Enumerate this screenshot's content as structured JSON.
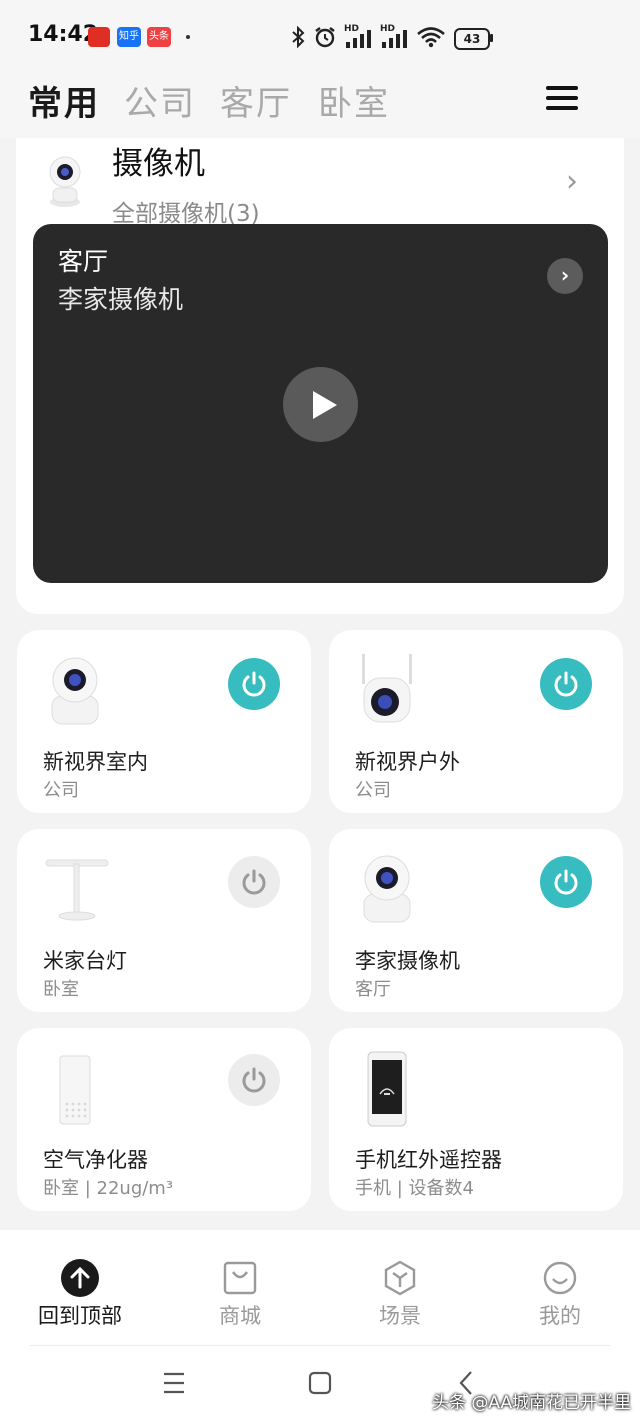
{
  "status_bar": {
    "time": "14:42",
    "app_icons": [
      "拼多多",
      "知乎",
      "头条"
    ],
    "battery": "43",
    "hd1": "HD",
    "hd2": "HD"
  },
  "tabs": [
    "常用",
    "公司",
    "客厅",
    "卧室"
  ],
  "active_tab": "常用",
  "camera_card": {
    "title": "摄像机",
    "subtitle": "全部摄像机(3)",
    "video": {
      "room": "客厅",
      "name": "李家摄像机"
    }
  },
  "devices": [
    {
      "name": "新视界室内",
      "room": "公司",
      "power": "on",
      "icon": "indoor-camera-icon"
    },
    {
      "name": "新视界户外",
      "room": "公司",
      "power": "on",
      "icon": "outdoor-camera-icon"
    },
    {
      "name": "米家台灯",
      "room": "卧室",
      "power": "off",
      "icon": "desk-lamp-icon"
    },
    {
      "name": "李家摄像机",
      "room": "客厅",
      "power": "on",
      "icon": "indoor-camera-icon"
    },
    {
      "name": "空气净化器",
      "room": "卧室 | 22ug/m³",
      "power": "off",
      "icon": "air-purifier-icon"
    },
    {
      "name": "手机红外遥控器",
      "room": "手机 | 设备数4",
      "power": null,
      "icon": "phone-remote-icon"
    }
  ],
  "bottom_nav": [
    {
      "label": "回到顶部",
      "icon": "arrow-up-icon",
      "active": true
    },
    {
      "label": "商城",
      "icon": "shop-bag-icon",
      "active": false
    },
    {
      "label": "场景",
      "icon": "scene-cube-icon",
      "active": false
    },
    {
      "label": "我的",
      "icon": "smile-face-icon",
      "active": false
    }
  ],
  "watermark": "头条 @AA城南花已开半里",
  "colors": {
    "power_on": "#37bcc0",
    "power_off": "#ececec",
    "video_bg": "#292929"
  }
}
